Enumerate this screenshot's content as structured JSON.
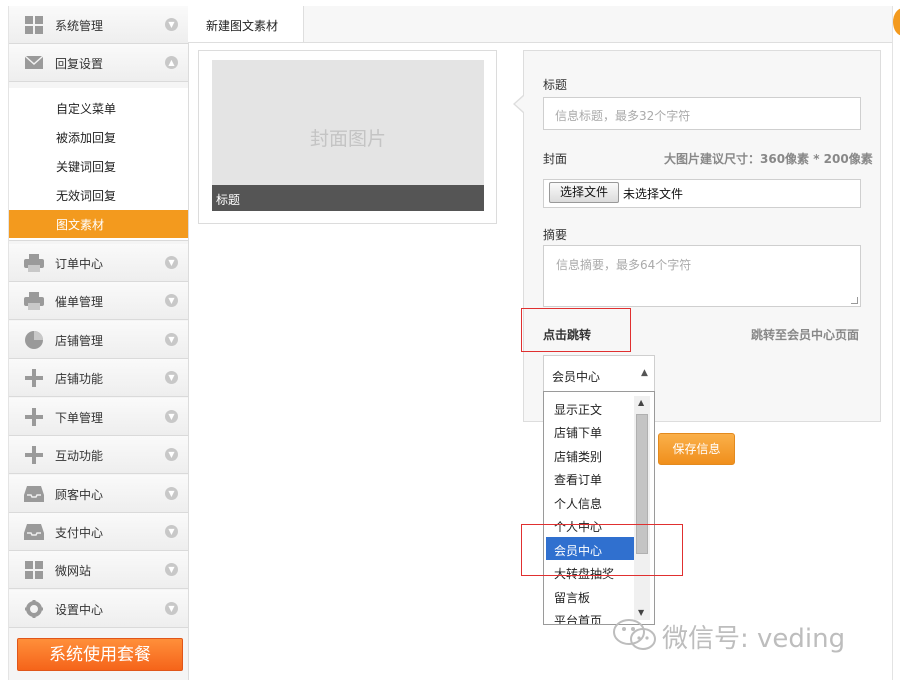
{
  "sidebar": {
    "top_items": [
      {
        "label": "系统管理",
        "icon": "grid-icon"
      },
      {
        "label": "回复设置",
        "icon": "envelope-icon"
      }
    ],
    "sub_items": [
      {
        "label": "自定义菜单"
      },
      {
        "label": "被添加回复"
      },
      {
        "label": "关键词回复"
      },
      {
        "label": "无效词回复"
      },
      {
        "label": "图文素材",
        "active": true
      }
    ],
    "items": [
      {
        "label": "订单中心",
        "icon": "printer-icon"
      },
      {
        "label": "催单管理",
        "icon": "printer-icon"
      },
      {
        "label": "店铺管理",
        "icon": "pie-chart-icon"
      },
      {
        "label": "店铺功能",
        "icon": "plus-icon"
      },
      {
        "label": "下单管理",
        "icon": "plus-icon"
      },
      {
        "label": "互动功能",
        "icon": "plus-icon"
      },
      {
        "label": "顾客中心",
        "icon": "inbox-icon"
      },
      {
        "label": "支付中心",
        "icon": "inbox-icon"
      },
      {
        "label": "微网站",
        "icon": "grid-icon"
      },
      {
        "label": "设置中心",
        "icon": "gear-icon"
      }
    ],
    "plan_button": "系统使用套餐"
  },
  "tabs": [
    {
      "label": "新建图文素材",
      "active": true
    }
  ],
  "preview": {
    "cover_text": "封面图片",
    "title_text": "标题"
  },
  "form": {
    "title_label": "标题",
    "title_placeholder": "信息标题，最多32个字符",
    "cover_label": "封面",
    "cover_hint": "大图片建议尺寸：360像素 * 200像素",
    "file_button": "选择文件",
    "file_status": "未选择文件",
    "summary_label": "摘要",
    "summary_placeholder": "信息摘要，最多64个字符",
    "jump_label": "点击跳转",
    "jump_hint": "跳转至会员中心页面",
    "select_value": "会员中心",
    "dropdown_options": [
      "显示正文",
      "店铺下单",
      "店铺类别",
      "查看订单",
      "个人信息",
      "个人中心",
      "会员中心",
      "大转盘抽奖",
      "留言板",
      "平台首页"
    ],
    "dropdown_selected": "会员中心",
    "save_button": "保存信息"
  },
  "watermark": {
    "text": "微信号: veding"
  },
  "colors": {
    "accent": "#f39a1e",
    "selected_option": "#3070cf",
    "highlight_box": "#e03030"
  }
}
